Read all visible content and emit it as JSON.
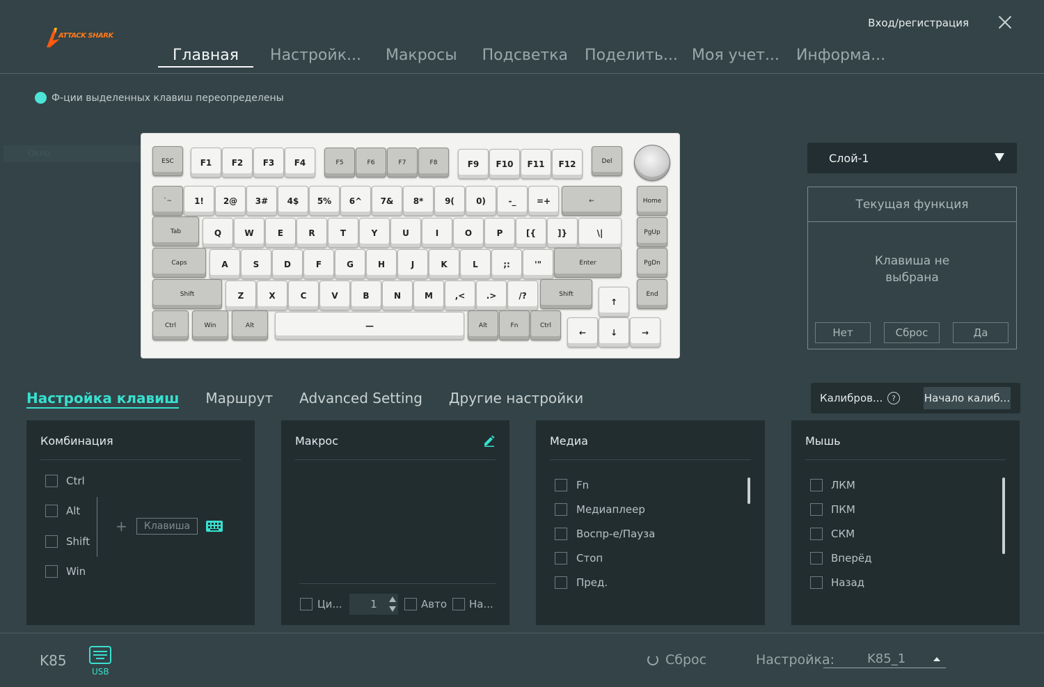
{
  "app": {
    "logo_text": "ATTACK SHARK"
  },
  "header": {
    "login": "Вход/регистрация",
    "nav": [
      "Главная",
      "Настройк...",
      "Макросы",
      "Подсветка",
      "Поделить...",
      "Моя учет...",
      "Информа..."
    ],
    "active_nav": "Главная"
  },
  "remap_note": "Ф-ции выделенных клавиш переопределены",
  "ghost_text": "Окно",
  "keyboard": {
    "rows": [
      [
        "ESC",
        "F1",
        "F2",
        "F3",
        "F4",
        "F5",
        "F6",
        "F7",
        "F8",
        "F9",
        "F10",
        "F11",
        "F12",
        "Del"
      ],
      [
        "`~",
        "1!",
        "2@",
        "3#",
        "4$",
        "5%",
        "6^",
        "7&",
        "8*",
        "9(",
        "0)",
        "-_",
        "=+",
        "←",
        "Home"
      ],
      [
        "Tab",
        "Q",
        "W",
        "E",
        "R",
        "T",
        "Y",
        "U",
        "I",
        "O",
        "P",
        "[{",
        "]}",
        "\\|",
        "PgUp"
      ],
      [
        "Caps",
        "A",
        "S",
        "D",
        "F",
        "G",
        "H",
        "J",
        "K",
        "L",
        ";:",
        "'\"",
        "Enter",
        "PgDn"
      ],
      [
        "Shift",
        "Z",
        "X",
        "C",
        "V",
        "B",
        "N",
        "M",
        ",<",
        ".>",
        "/?",
        "Shift",
        "↑",
        "End"
      ],
      [
        "Ctrl",
        "Win",
        "Alt",
        "—",
        "Alt",
        "Fn",
        "Ctrl",
        "←",
        "↓",
        "→"
      ]
    ]
  },
  "layer": {
    "selected": "Слой-1"
  },
  "current_function": {
    "title": "Текущая функция",
    "status": "Клавиша не выбрана",
    "buttons": [
      "Нет",
      "Сброс",
      "Да"
    ]
  },
  "subtabs": [
    "Настройка клавиш",
    "Маршрут",
    "Advanced Setting",
    "Другие настройки"
  ],
  "calibration": {
    "label": "Калибров...",
    "help": "?",
    "start": "Начало калиб..."
  },
  "combo": {
    "title": "Комбинация",
    "modifiers": [
      "Ctrl",
      "Alt",
      "Shift",
      "Win"
    ],
    "plus": "+",
    "key_placeholder": "Клавиша"
  },
  "macro": {
    "title": "Макрос",
    "loop_label": "Ци...",
    "loop_value": "1",
    "auto_label": "Авто",
    "na_label": "На..."
  },
  "media": {
    "title": "Медиа",
    "items": [
      "Fn",
      "Медиаплеер",
      "Воспр-е/Пауза",
      "Стоп",
      "Пред."
    ]
  },
  "mouse": {
    "title": "Мышь",
    "items": [
      "ЛКМ",
      "ПКМ",
      "СКМ",
      "Вперёд",
      "Назад"
    ]
  },
  "footer": {
    "model": "K85",
    "connection": "USB",
    "reset": "Сброс",
    "profile_label": "Настройка:",
    "profile_value": "K85_1"
  },
  "colors": {
    "accent": "#38e0d0",
    "background": "#334347",
    "panel": "#222d30"
  }
}
